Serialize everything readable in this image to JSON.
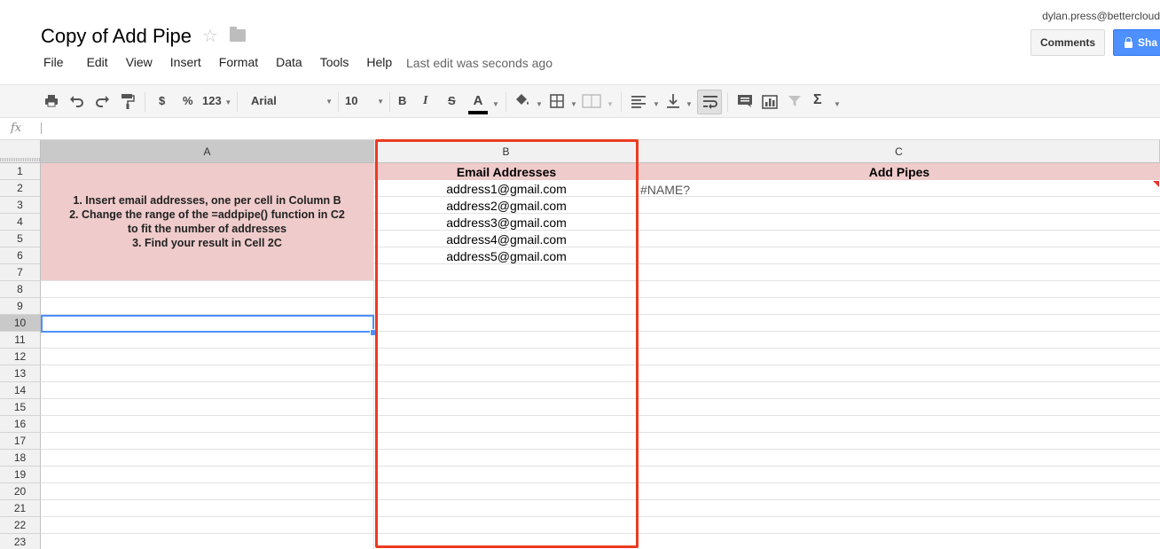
{
  "document": {
    "title": "Copy of Add Pipe",
    "last_edit": "Last edit was seconds ago"
  },
  "account": {
    "email": "dylan.press@bettercloud",
    "comments_label": "Comments",
    "share_label": "Sha"
  },
  "menu": [
    "File",
    "Edit",
    "View",
    "Insert",
    "Format",
    "Data",
    "Tools",
    "Help"
  ],
  "toolbar": {
    "currency": "$",
    "percent": "%",
    "number_format": "123",
    "font_family": "Arial",
    "font_size": "10",
    "bold": "B",
    "italic": "I",
    "strikethrough": "S",
    "text_color": "A",
    "sum": "Σ"
  },
  "formula_bar": {
    "icon": "fx",
    "value": ""
  },
  "sheet": {
    "columns": [
      "A",
      "B",
      "C"
    ],
    "selected_column": "A",
    "selected_row": "10",
    "rows": [
      "1",
      "2",
      "3",
      "4",
      "5",
      "6",
      "7",
      "8",
      "9",
      "10",
      "11",
      "12",
      "13",
      "14",
      "15",
      "16",
      "17",
      "18",
      "19",
      "20",
      "21",
      "22",
      "23"
    ],
    "instructions": [
      "1. Insert email addresses, one per cell in Column B",
      "2. Change the range of the =addpipe() function in C2",
      "to fit the number of addresses",
      "3. Find your result in Cell 2C"
    ],
    "header_b": "Email Addresses",
    "header_c": "Add Pipes",
    "emails": [
      "address1@gmail.com",
      "address2@gmail.com",
      "address3@gmail.com",
      "address4@gmail.com",
      "address5@gmail.com"
    ],
    "c2_value": "#NAME?"
  },
  "colors": {
    "header_fill": "#efcbcb",
    "selection": "#4d90fe",
    "annotation": "#ec3b22",
    "share_button": "#4d90fe"
  }
}
